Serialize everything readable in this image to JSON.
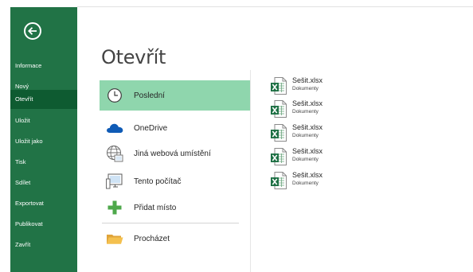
{
  "colors": {
    "sidebar": "#217346",
    "sidebar_active": "#0e5b31",
    "selected_place": "#8fd6ad",
    "onedrive": "#0f5bb6",
    "add_place": "#4ea84b",
    "folder": "#f4c04e"
  },
  "sidebar": {
    "back_icon": "back-arrow-icon",
    "items": [
      {
        "label": "Informace"
      },
      {
        "label": "Nový"
      },
      {
        "label": "Otevřít",
        "active": true
      },
      {
        "label": "Uložit"
      },
      {
        "label": "Uložit jako"
      },
      {
        "label": "Tisk"
      },
      {
        "label": "Sdílet"
      },
      {
        "label": "Exportovat"
      },
      {
        "label": "Publikovat"
      },
      {
        "label": "Zavřít"
      }
    ]
  },
  "main": {
    "title": "Otevřít",
    "places": [
      {
        "label": "Poslední",
        "icon": "clock-icon",
        "selected": true
      },
      {
        "label": "OneDrive",
        "icon": "cloud-icon"
      },
      {
        "label": "Jiná webová umístění",
        "icon": "globe-icon"
      },
      {
        "label": "Tento počítač",
        "icon": "computer-icon"
      },
      {
        "label": "Přidat místo",
        "icon": "plus-icon"
      },
      {
        "label": "Procházet",
        "icon": "folder-icon"
      }
    ]
  },
  "recent_files": [
    {
      "name": "Sešit.xlsx",
      "location": "Dokumenty",
      "icon": "excel-file-icon"
    },
    {
      "name": "Sešit.xlsx",
      "location": "Dokumenty",
      "icon": "excel-file-icon"
    },
    {
      "name": "Sešit.xlsx",
      "location": "Dokumenty",
      "icon": "excel-file-icon"
    },
    {
      "name": "Sešit.xlsx",
      "location": "Dokumenty",
      "icon": "excel-file-icon"
    },
    {
      "name": "Sešit.xlsx",
      "location": "Dokumenty",
      "icon": "excel-file-icon"
    }
  ]
}
